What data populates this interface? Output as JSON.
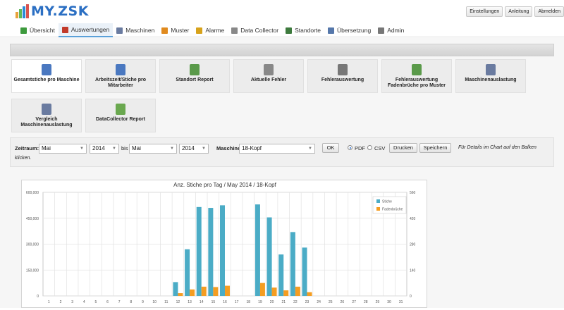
{
  "app": {
    "logo_text": "MY.ZSK",
    "logo_bar_colors": [
      "#e8a23a",
      "#5fb85a",
      "#2b8ad8",
      "#d9534f"
    ]
  },
  "top_buttons": {
    "settings": "Einstellungen",
    "manual": "Anleitung",
    "logout": "Abmelden"
  },
  "nav": {
    "items": [
      {
        "label": "Übersicht",
        "icon": "table-icon",
        "color": "#3d9a3d"
      },
      {
        "label": "Auswertungen",
        "icon": "bar-chart-icon",
        "color": "#c23b2b"
      },
      {
        "label": "Maschinen",
        "icon": "machine-icon",
        "color": "#6a7ba0"
      },
      {
        "label": "Muster",
        "icon": "pattern-icon",
        "color": "#e08a1e"
      },
      {
        "label": "Alarme",
        "icon": "alarm-icon",
        "color": "#d7a21b"
      },
      {
        "label": "Data Collector",
        "icon": "data-collector-icon",
        "color": "#888888"
      },
      {
        "label": "Standorte",
        "icon": "location-icon",
        "color": "#3d7a3d"
      },
      {
        "label": "Übersetzung",
        "icon": "translation-icon",
        "color": "#5577aa"
      },
      {
        "label": "Admin",
        "icon": "gear-icon",
        "color": "#777777"
      }
    ],
    "active_index": 1
  },
  "reports": {
    "tiles": [
      {
        "label": "Gesamtstiche pro Maschine",
        "icon": "document-icon",
        "color": "#4a78c0"
      },
      {
        "label": "Arbeitszeit/Stiche pro Mitarbeiter",
        "icon": "user-document-icon",
        "color": "#4a78c0"
      },
      {
        "label": "Standort Report",
        "icon": "edit-report-icon",
        "color": "#5a9a4a"
      },
      {
        "label": "Aktuelle Fehler",
        "icon": "warning-gear-icon",
        "color": "#888888"
      },
      {
        "label": "Fehlerauswertung",
        "icon": "printer-warning-icon",
        "color": "#777777"
      },
      {
        "label": "Fehlerauswertung Fadenbrüche pro Muster",
        "icon": "image-warning-icon",
        "color": "#5a9a4a"
      },
      {
        "label": "Maschinenauslastung",
        "icon": "document-clock-icon",
        "color": "#6a7ba0"
      },
      {
        "label": "Vergleich Maschinenauslastung",
        "icon": "documents-icon",
        "color": "#6a7ba0"
      },
      {
        "label": "DataCollector Report",
        "icon": "database-icon",
        "color": "#6aa84f"
      }
    ],
    "selected_index": 0
  },
  "filter": {
    "period_label": "Zeitraum:",
    "from_month": "Mai",
    "from_year": "2014",
    "until_label": "bis",
    "to_month": "Mai",
    "to_year": "2014",
    "machine_label": "Maschine:",
    "machine_value": "18-Kopf",
    "ok_label": "OK",
    "pdf_label": "PDF",
    "csv_label": "CSV",
    "print_label": "Drucken",
    "save_label": "Speichern",
    "hint_line1": "Für Details im Chart auf den Balken",
    "hint_line2": "klicken."
  },
  "chart_data": {
    "type": "bar",
    "title": "Anz. Stiche pro Tag / May 2014 / 18-Kopf",
    "categories": [
      "1",
      "2",
      "3",
      "4",
      "5",
      "6",
      "7",
      "8",
      "9",
      "10",
      "11",
      "12",
      "13",
      "14",
      "15",
      "16",
      "17",
      "18",
      "19",
      "20",
      "21",
      "22",
      "23",
      "24",
      "25",
      "26",
      "27",
      "28",
      "29",
      "30",
      "31"
    ],
    "series": [
      {
        "name": "Stiche",
        "axis": "left",
        "color": "#4bacc6",
        "values": [
          0,
          0,
          0,
          0,
          0,
          0,
          0,
          0,
          0,
          0,
          0,
          80000,
          270000,
          515000,
          510000,
          525000,
          0,
          0,
          530000,
          455000,
          240000,
          370000,
          280000,
          0,
          0,
          0,
          0,
          0,
          0,
          0,
          0
        ]
      },
      {
        "name": "Fadenbrüche",
        "axis": "right",
        "color": "#f59d21",
        "values": [
          0,
          0,
          0,
          0,
          0,
          0,
          0,
          0,
          0,
          0,
          0,
          15,
          35,
          50,
          48,
          55,
          0,
          0,
          70,
          45,
          30,
          50,
          20,
          0,
          0,
          0,
          0,
          0,
          0,
          0,
          0
        ]
      }
    ],
    "y_left": {
      "min": 0,
      "max": 600000,
      "ticks": [
        "0",
        "150,000",
        "300,000",
        "450,000",
        "600,000"
      ]
    },
    "y_right": {
      "min": 0,
      "max": 560,
      "ticks": [
        "0",
        "140",
        "280",
        "420",
        "560"
      ]
    },
    "legend_position": "top-right",
    "grid": true
  }
}
